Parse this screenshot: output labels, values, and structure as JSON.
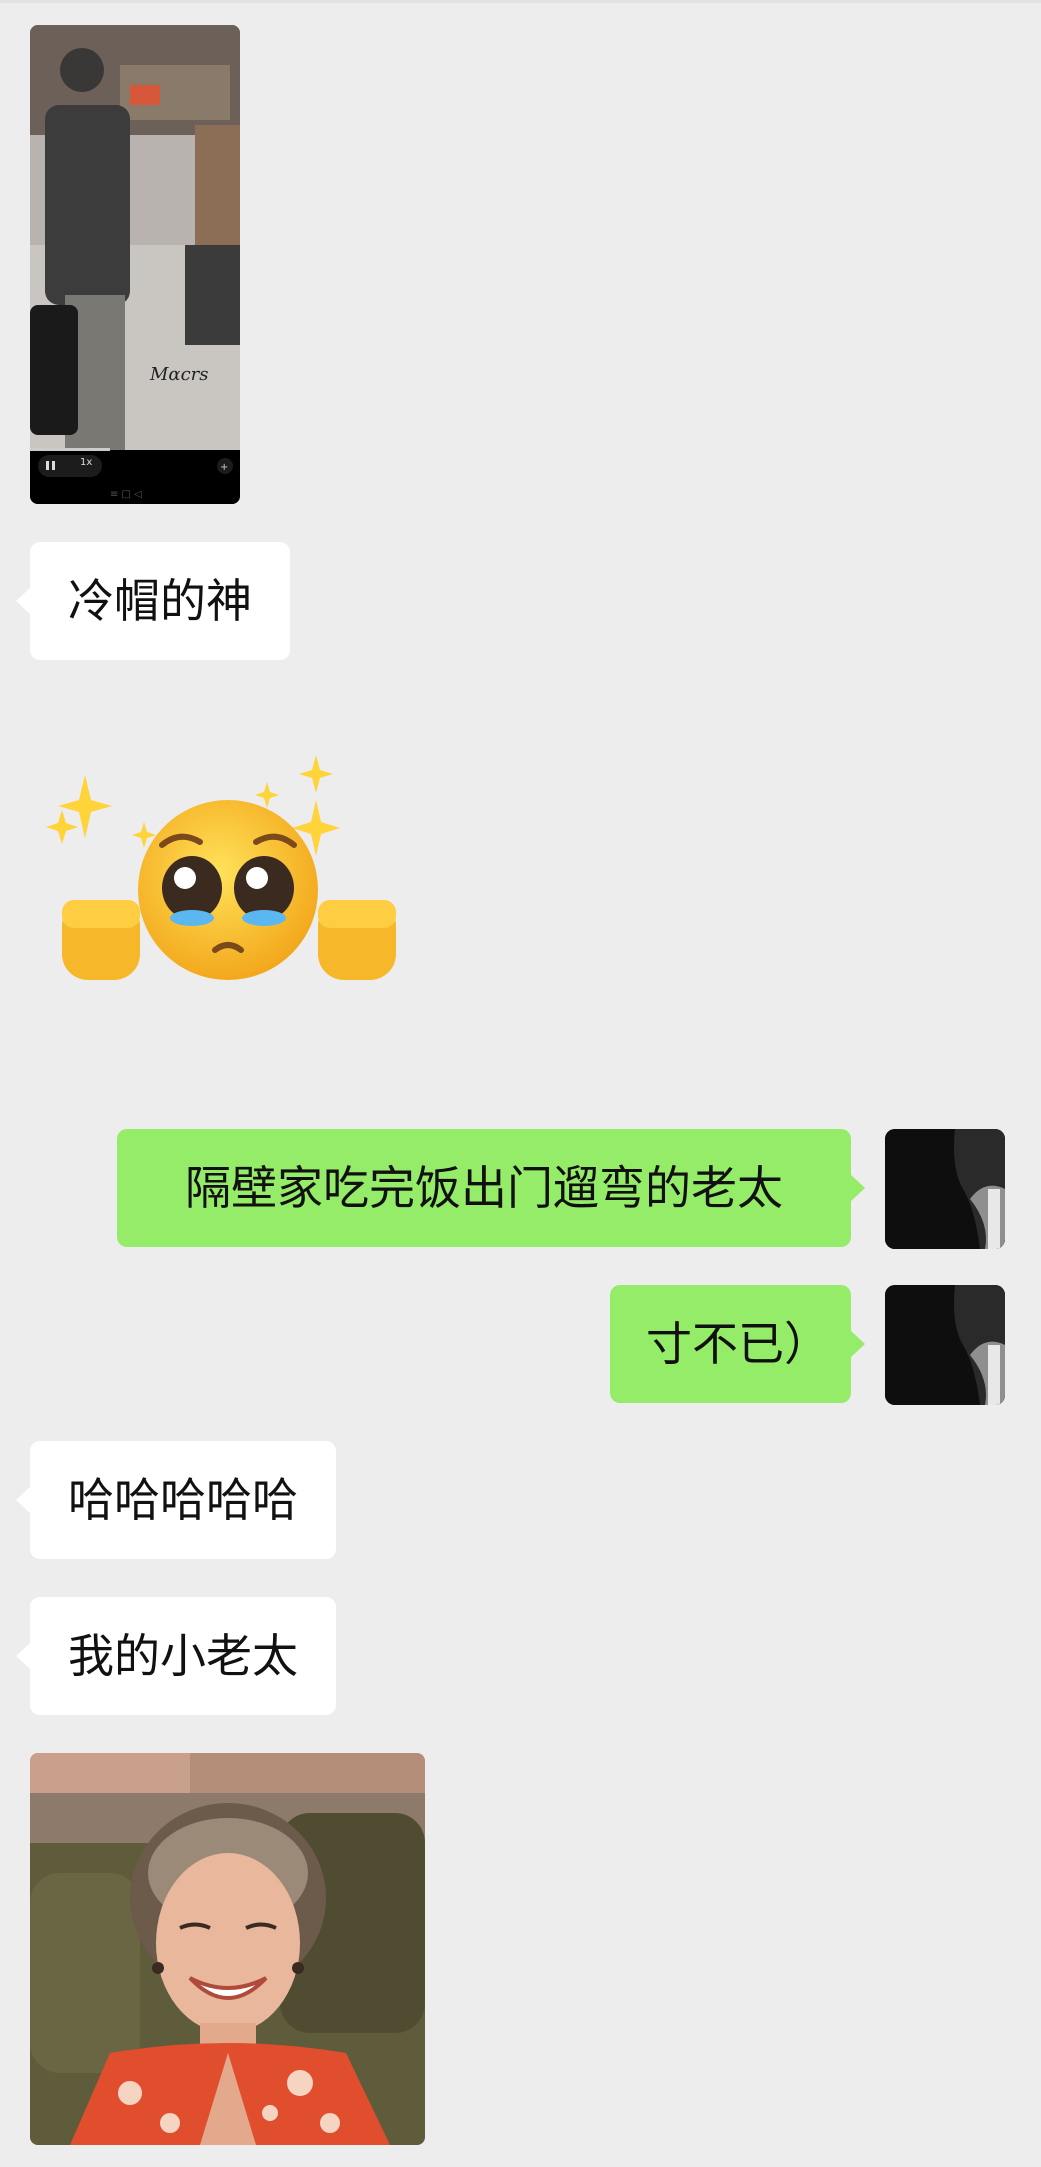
{
  "chat": {
    "messages": [
      {
        "type": "video",
        "from": "other",
        "description": "video thumbnail",
        "speed_label": "1x"
      },
      {
        "type": "text",
        "from": "other",
        "text": "冷帽的神"
      },
      {
        "type": "sticker",
        "from": "other",
        "emoji": "🥺✊✨"
      },
      {
        "type": "text",
        "from": "me",
        "text": "隔壁家吃完饭出门遛弯的老太"
      },
      {
        "type": "text",
        "from": "me",
        "text": "寸不已）"
      },
      {
        "type": "text",
        "from": "other",
        "text": "哈哈哈哈哈"
      },
      {
        "type": "text",
        "from": "other",
        "text": "我的小老太"
      },
      {
        "type": "image",
        "from": "other",
        "description": "photo"
      }
    ]
  },
  "colors": {
    "background": "#ededed",
    "incoming_bubble": "#ffffff",
    "outgoing_bubble": "#95ec69"
  }
}
